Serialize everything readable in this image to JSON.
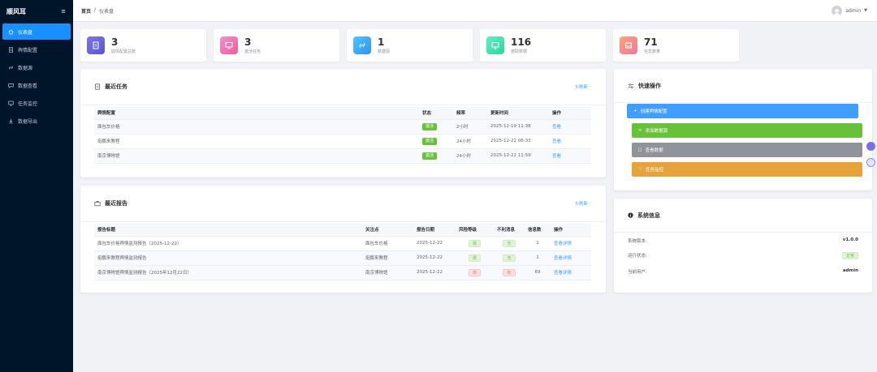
{
  "app": {
    "title": "顺风耳"
  },
  "sidebar": {
    "items": [
      {
        "label": "仪表盘",
        "icon": "home-icon",
        "active": true
      },
      {
        "label": "舆情配置",
        "icon": "document-icon"
      },
      {
        "label": "数据源",
        "icon": "link-icon"
      },
      {
        "label": "数据查看",
        "icon": "message-icon"
      },
      {
        "label": "任务监控",
        "icon": "monitor-icon"
      },
      {
        "label": "数据导出",
        "icon": "download-icon"
      }
    ]
  },
  "header": {
    "breadcrumb": [
      "首页",
      "/",
      "仪表盘"
    ],
    "user": "admin"
  },
  "stats": [
    {
      "value": "3",
      "label": "舆情配置总数",
      "color": "#6a66d8"
    },
    {
      "value": "3",
      "label": "激活任务",
      "color": "#f06bb6"
    },
    {
      "value": "1",
      "label": "数据源",
      "color": "#3fb0f5"
    },
    {
      "value": "116",
      "label": "爬取数据",
      "color": "#3fe0b0"
    },
    {
      "value": "71",
      "label": "信息数量",
      "color": "#f7906a"
    }
  ],
  "tasks": {
    "title": "最近任务",
    "refresh": "刷新",
    "columns": [
      "舆情配置",
      "状态",
      "频率",
      "更新时间",
      "操作"
    ],
    "rows": [
      {
        "name": "面包车价格",
        "status": "激活",
        "freq": "2小时",
        "time": "2025-12-19 11:38",
        "action": "查看"
      },
      {
        "name": "挺鹏来教程",
        "status": "激活",
        "freq": "24小时",
        "time": "2025-12-22 06:33",
        "action": "查看"
      },
      {
        "name": "南京博物馆",
        "status": "激活",
        "freq": "24小时",
        "time": "2025-12-22 11:59",
        "action": "查看"
      }
    ]
  },
  "reports": {
    "title": "最近报告",
    "refresh": "刷新",
    "columns": [
      "报告标题",
      "关注点",
      "报告日期",
      "风险等级",
      "不利消息",
      "信息数",
      "操作"
    ],
    "rows": [
      {
        "title": "面包车价格舆情监测报告（2025-12-22）",
        "focus": "面包车价格",
        "date": "2025-12-22",
        "risk": "低",
        "neg": "无",
        "count": "1",
        "action": "查看详情"
      },
      {
        "title": "挺鹏来教程舆情监测报告",
        "focus": "挺鹏来教程",
        "date": "2025-12-22",
        "risk": "低",
        "neg": "无",
        "count": "1",
        "action": "查看详情"
      },
      {
        "title": "南京博物馆舆情监测报告（2025年12月22日）",
        "focus": "南京博物馆",
        "date": "2025-12-22",
        "risk": "高",
        "neg": "有",
        "count": "69",
        "action": "查看详情"
      }
    ]
  },
  "quick": {
    "title": "快速操作",
    "buttons": [
      {
        "label": "创建舆情配置",
        "color": "#409eff"
      },
      {
        "label": "添加数据源",
        "color": "#67c23a"
      },
      {
        "label": "查看数据",
        "color": "#909399"
      },
      {
        "label": "任务监控",
        "color": "#e6a23c"
      }
    ]
  },
  "sysinfo": {
    "title": "系统信息",
    "rows": [
      {
        "label": "系统版本:",
        "value": "v1.0.0"
      },
      {
        "label": "运行状态:",
        "value": "正常"
      },
      {
        "label": "当前用户:",
        "value": "admin"
      }
    ]
  }
}
